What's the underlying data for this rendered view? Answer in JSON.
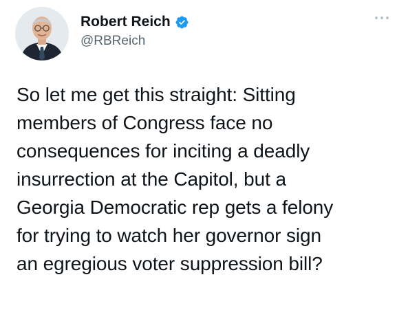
{
  "author": {
    "display_name": "Robert Reich",
    "handle": "@RBReich",
    "verified": true,
    "avatar_icon": "profile-photo",
    "verified_icon": "verified-badge-icon"
  },
  "menu": {
    "more_icon": "more-options-icon"
  },
  "tweet": {
    "lines": [
      "So let me get this straight: Sitting",
      "members of Congress face no",
      "consequences for inciting a deadly",
      "insurrection at the Capitol, but a",
      "Georgia Democratic rep gets a felony",
      "for trying to watch her governor sign",
      "an egregious voter suppression bill?"
    ]
  },
  "colors": {
    "verified_blue": "#1d9bf0",
    "text_primary": "#0f1419",
    "text_secondary": "#536471",
    "more_dots": "#b9c3cc"
  }
}
